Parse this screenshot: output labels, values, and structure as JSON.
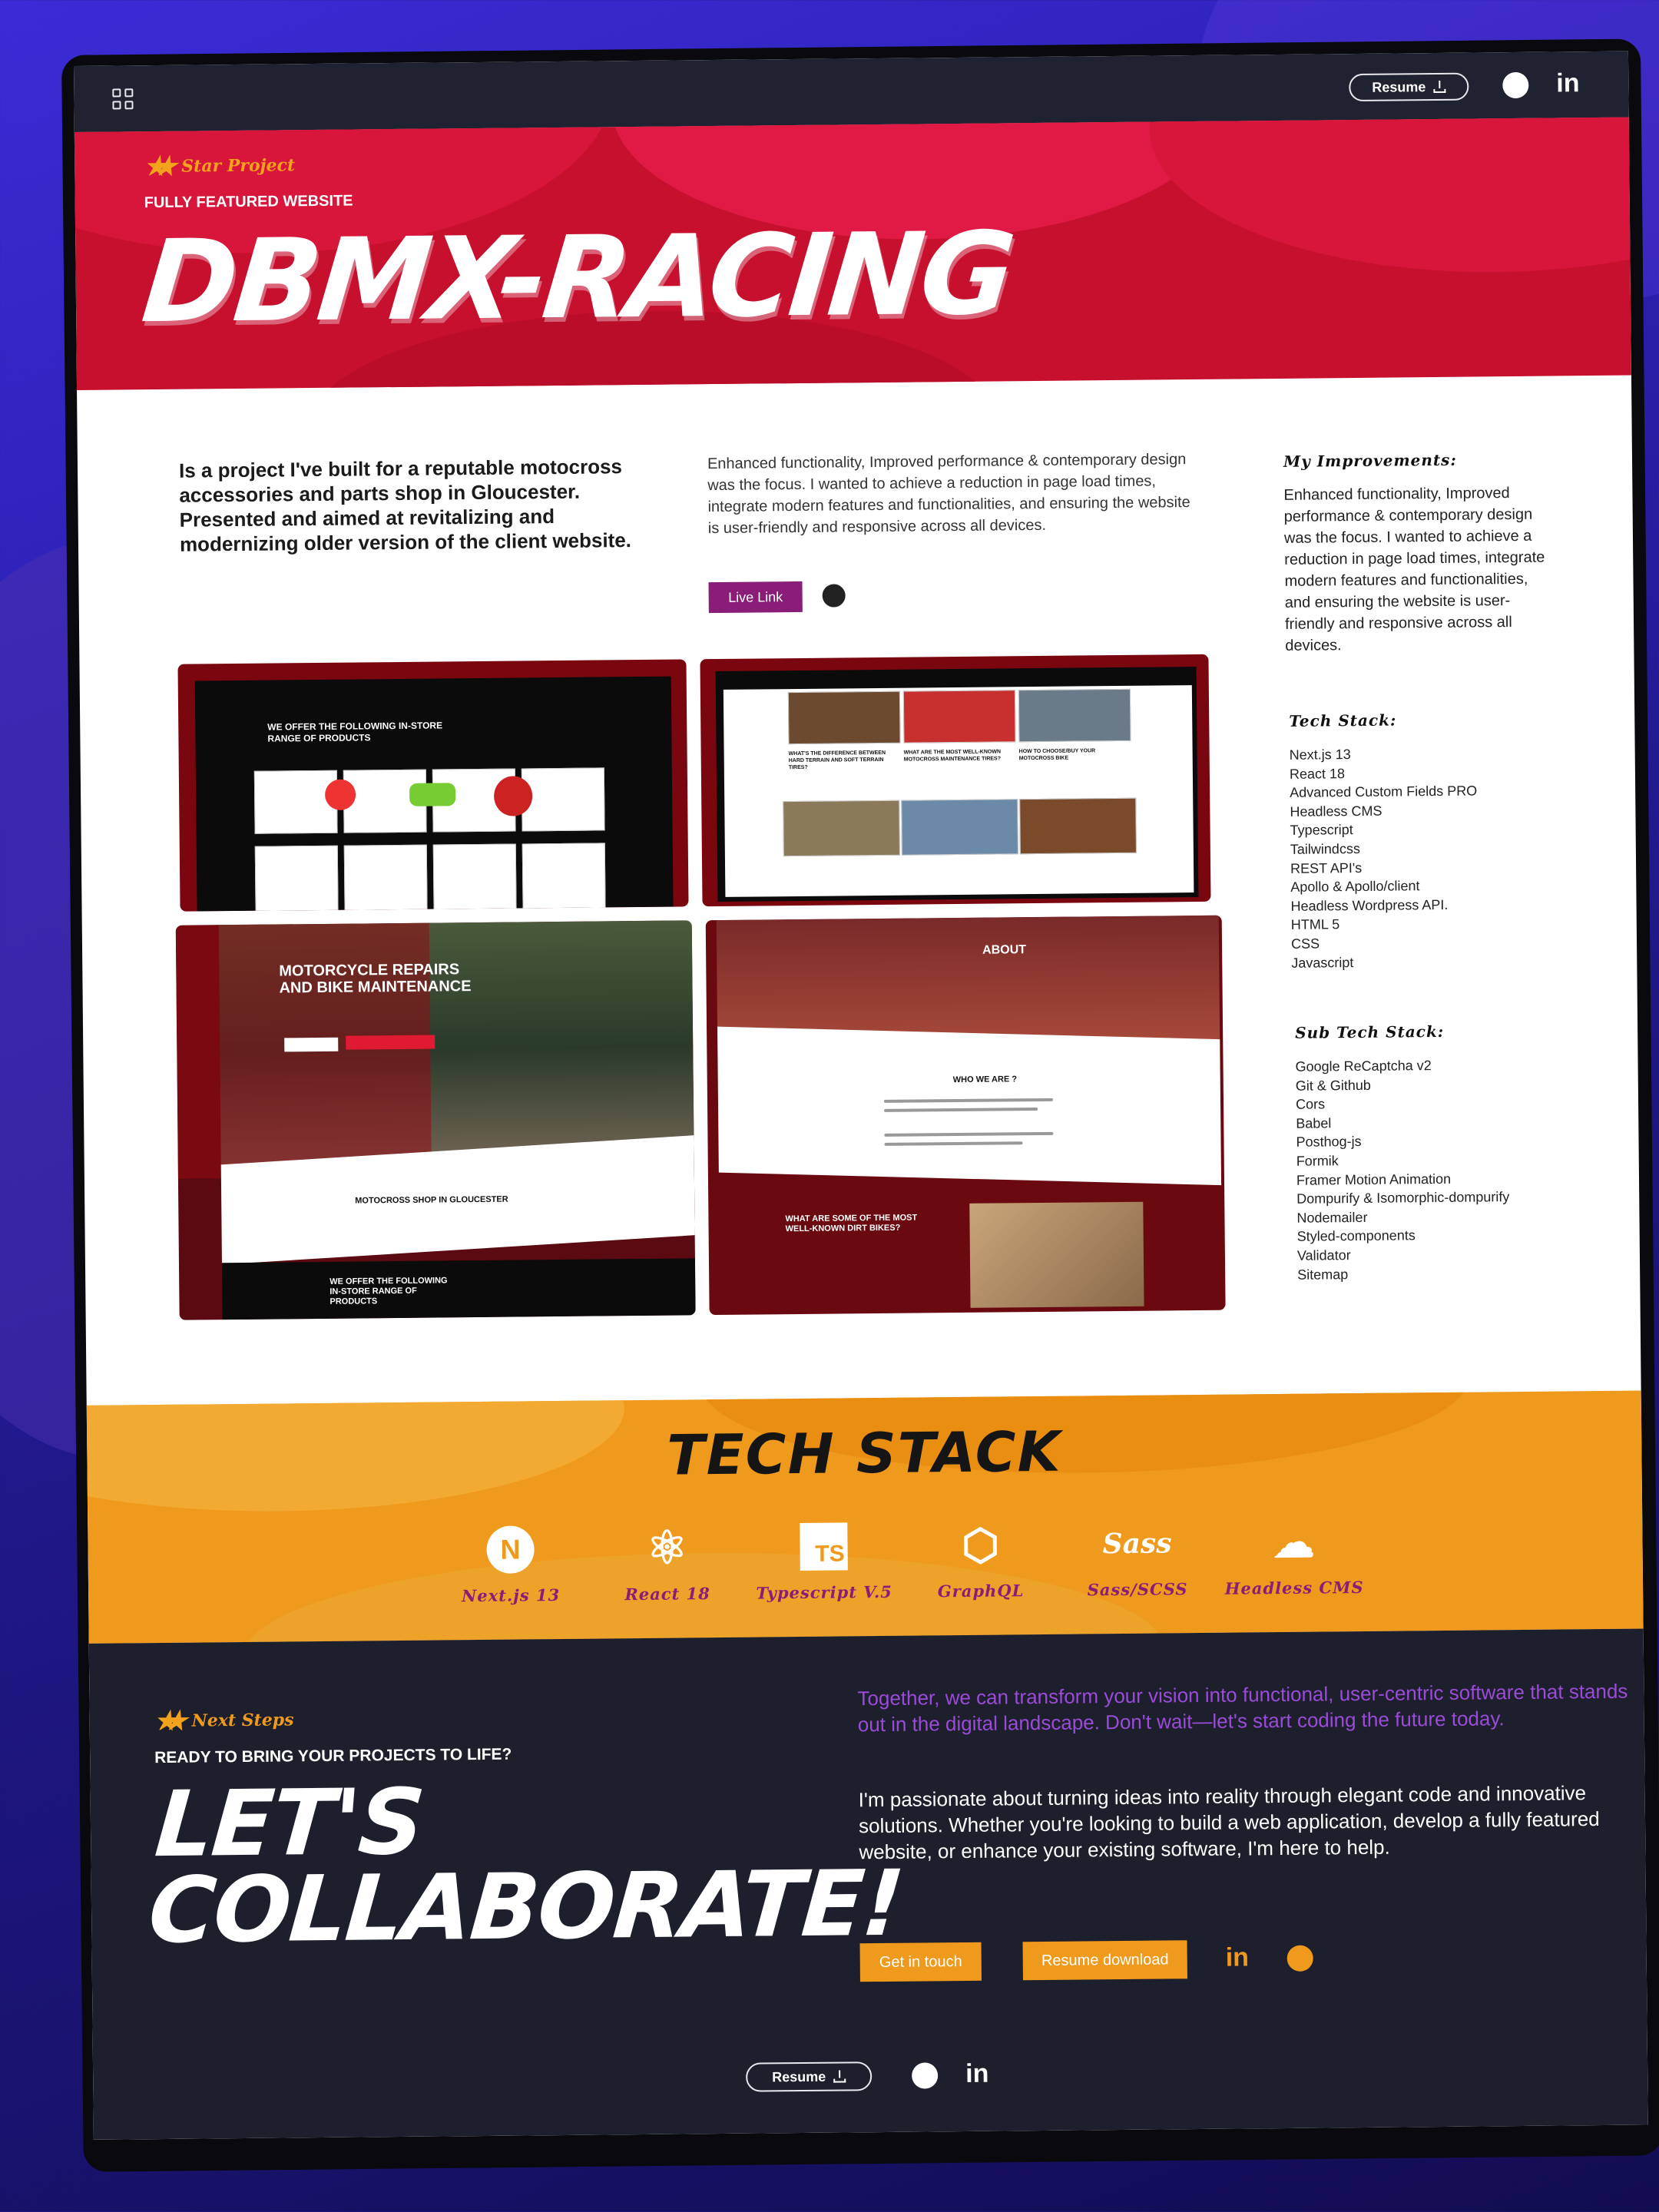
{
  "header": {
    "resume_label": "Resume"
  },
  "hero": {
    "badge": "Star Project",
    "subtitle": "FULLY FEATURED WEBSITE",
    "title": "DBMX-RACING"
  },
  "intro": "Is a project I've built for a reputable motocross accessories and parts shop in Gloucester. Presented and aimed at revitalizing and modernizing older version of the client website.",
  "description": "Enhanced functionality, Improved performance & contemporary design was the focus. I wanted to achieve a reduction in page load times, integrate modern features and functionalities, and ensuring the website is user-friendly and responsive across all devices.",
  "live_link_label": "Live Link",
  "sidebar": {
    "improvements_heading": "My Improvements:",
    "improvements_text": "Enhanced functionality, Improved performance & contemporary design was the focus. I wanted to achieve a reduction in page load times, integrate modern features and functionalities, and ensuring the website is user-friendly and responsive across all devices.",
    "tech_heading": "Tech Stack:",
    "tech_list": [
      "Next.js 13",
      "React 18",
      "Advanced Custom Fields PRO",
      "Headless CMS",
      "Typescript",
      "Tailwindcss",
      "REST API's",
      "Apollo & Apollo/client",
      "Headless Wordpress API.",
      "HTML 5",
      "CSS",
      "Javascript"
    ],
    "subtech_heading": "Sub Tech Stack:",
    "subtech_list": [
      "Google ReCaptcha v2",
      "Git & Github",
      "Cors",
      "Babel",
      "Posthog-js",
      "Formik",
      "Framer Motion Animation",
      "Dompurify & Isomorphic-dompurify",
      "Nodemailer",
      "Styled-components",
      "Validator",
      "Sitemap"
    ]
  },
  "screens": {
    "s1_heading": "WE OFFER THE FOLLOWING IN-STORE RANGE OF PRODUCTS",
    "s2_items": [
      "WHAT'S THE DIFFERENCE BETWEEN HARD TERRAIN AND SOFT TERRAIN TIRES?",
      "WHAT ARE THE MOST WELL-KNOWN MOTOCROSS MAINTENANCE TIRES?",
      "HOW TO CHOOSE/BUY YOUR MOTOCROSS BIKE"
    ],
    "s3_heading": "MOTORCYCLE REPAIRS AND BIKE MAINTENANCE",
    "s3_shop": "MOTOCROSS SHOP IN GLOUCESTER",
    "s3_offer": "WE OFFER THE FOLLOWING IN-STORE RANGE OF PRODUCTS",
    "s4_about": "ABOUT",
    "s4_who": "WHO WE ARE ?",
    "s4_heading": "WHAT ARE SOME OF THE MOST WELL-KNOWN DIRT BIKES?"
  },
  "tech_band": {
    "title": "TECH STACK",
    "items": [
      {
        "label": "Next.js 13",
        "icon": "nextjs-icon"
      },
      {
        "label": "React 18",
        "icon": "react-icon"
      },
      {
        "label": "Typescript V.5",
        "icon": "typescript-icon"
      },
      {
        "label": "GraphQL",
        "icon": "graphql-icon"
      },
      {
        "label": "Sass/SCSS",
        "icon": "sass-icon"
      },
      {
        "label": "Headless CMS",
        "icon": "cloud-database-icon"
      }
    ]
  },
  "footer": {
    "badge": "Next Steps",
    "subtitle": "READY TO BRING YOUR PROJECTS TO LIFE?",
    "title_line1": "LET'S",
    "title_line2": "COLLABORATE!",
    "purple_text": "Together, we can transform your vision into functional, user-centric software that stands out in the digital landscape. Don't wait—let's start coding the future today.",
    "white_text": "I'm passionate about turning ideas into reality through elegant code and innovative solutions. Whether you're looking to build a web application, develop a fully featured website, or enhance your existing software, I'm here to help.",
    "get_in_touch": "Get in touch",
    "resume_download": "Resume download",
    "resume_label": "Resume"
  },
  "colors": {
    "hero_red": "#c7102e",
    "orange": "#ef9a1c",
    "purple": "#8a1d77",
    "dark": "#1d202c"
  }
}
